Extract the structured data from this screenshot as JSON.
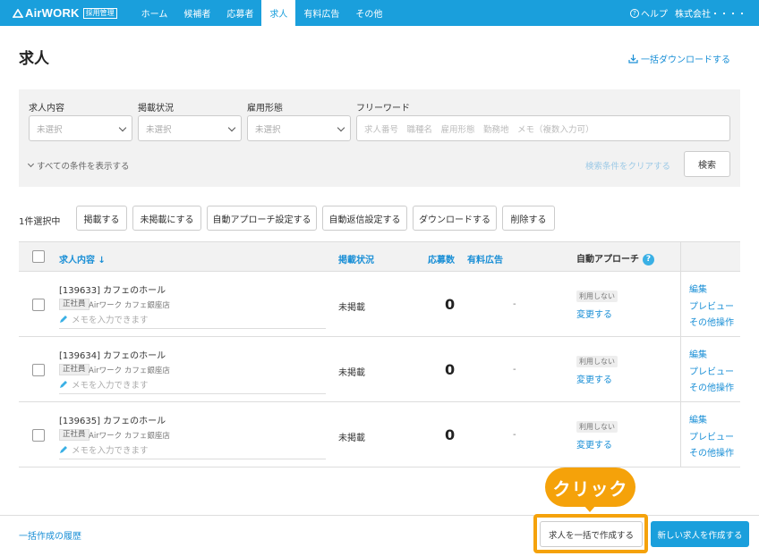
{
  "nav": {
    "logo": "AirWORK",
    "logo_badge": "採用管理",
    "items": [
      "ホーム",
      "候補者",
      "応募者",
      "求人",
      "有料広告",
      "その他"
    ],
    "active_index": 3,
    "help": "ヘルプ",
    "company": "株式会社・・・・"
  },
  "page": {
    "title": "求人",
    "bulk_download": "一括ダウンロードする"
  },
  "filter": {
    "labels": [
      "求人内容",
      "掲載状況",
      "雇用形態",
      "フリーワード"
    ],
    "select_placeholder": "未選択",
    "free_placeholder": "求人番号　職種名　雇用形態　勤務地　メモ（複数入力可）",
    "show_all": "すべての条件を表示する",
    "clear": "検索条件をクリアする",
    "search": "検索"
  },
  "actions": {
    "selected": "1件選択中",
    "buttons": [
      "掲載する",
      "未掲載にする",
      "自動アプローチ設定する",
      "自動返信設定する",
      "ダウンロードする",
      "削除する"
    ]
  },
  "table": {
    "headers": {
      "content": "求人内容",
      "status": "掲載状況",
      "applicants": "応募数",
      "paid": "有料広告",
      "auto": "自動アプローチ",
      "help": "?"
    },
    "rows": [
      {
        "title": "[139633] カフェのホール",
        "tag": "正社員",
        "store": "Airワーク カフェ銀座店",
        "memo": "メモを入力できます",
        "status": "未掲載",
        "count": "0",
        "paid": "-",
        "auto": "利用しない",
        "change": "変更する",
        "edit": "編集",
        "preview": "プレビュー",
        "other": "その他操作"
      },
      {
        "title": "[139634] カフェのホール",
        "tag": "正社員",
        "store": "Airワーク カフェ銀座店",
        "memo": "メモを入力できます",
        "status": "未掲載",
        "count": "0",
        "paid": "-",
        "auto": "利用しない",
        "change": "変更する",
        "edit": "編集",
        "preview": "プレビュー",
        "other": "その他操作"
      },
      {
        "title": "[139635] カフェのホール",
        "tag": "正社員",
        "store": "Airワーク カフェ銀座店",
        "memo": "メモを入力できます",
        "status": "未掲載",
        "count": "0",
        "paid": "-",
        "auto": "利用しない",
        "change": "変更する",
        "edit": "編集",
        "preview": "プレビュー",
        "other": "その他操作"
      }
    ]
  },
  "footer": {
    "history": "一括作成の履歴",
    "bulk_create": "求人を一括で作成する",
    "new_create": "新しい求人を作成する"
  },
  "callout": "クリック",
  "colors": {
    "accent": "#1a9fdc",
    "highlight": "#f5a20a"
  }
}
